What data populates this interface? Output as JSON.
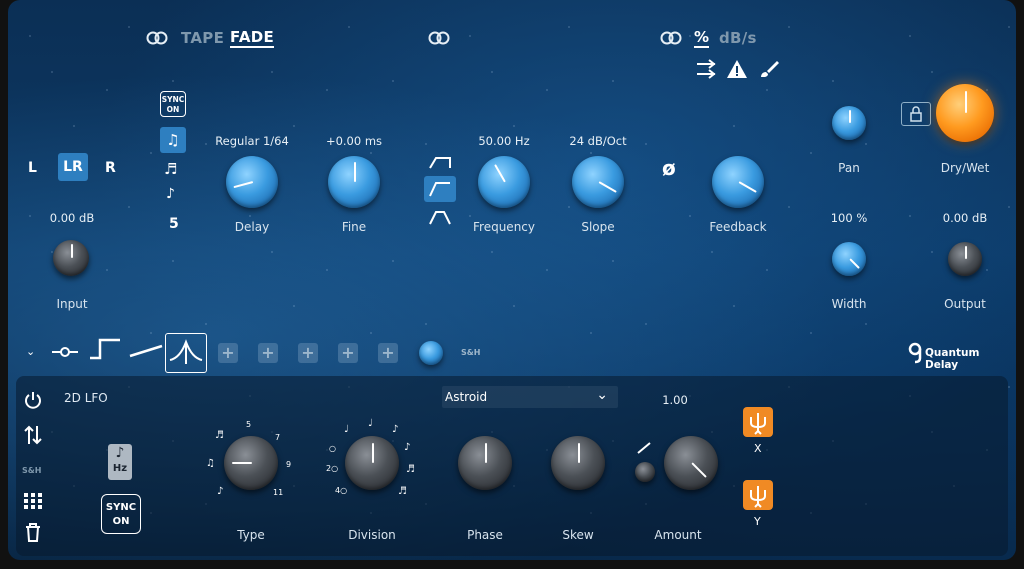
{
  "header": {
    "tape_label": "TAPE",
    "fade_label": "FADE",
    "percent_label": "%",
    "dbs_label": "dB/s"
  },
  "channel": {
    "l": "L",
    "lr": "LR",
    "r": "R"
  },
  "sync_top": {
    "line1": "SYNC",
    "line2": "ON"
  },
  "note_count": "5",
  "knobs": {
    "input": {
      "label": "Input",
      "value": "0.00 dB"
    },
    "delay": {
      "label": "Delay",
      "value": "Regular 1/64"
    },
    "fine": {
      "label": "Fine",
      "value": "+0.00 ms"
    },
    "frequency": {
      "label": "Frequency",
      "value": "50.00 Hz"
    },
    "slope": {
      "label": "Slope",
      "value": "24 dB/Oct"
    },
    "feedback": {
      "label": "Feedback"
    },
    "pan": {
      "label": "Pan"
    },
    "drywet": {
      "label": "Dry/Wet"
    },
    "width": {
      "label": "Width",
      "value": "100 %"
    },
    "output": {
      "label": "Output",
      "value": "0.00 dB"
    }
  },
  "phase_symbol": "ø",
  "mod_row": {
    "sh_label": "S&H"
  },
  "brand": {
    "name": "Quantum Delay"
  },
  "lfo": {
    "title": "2D LFO",
    "shape": "Astroid",
    "amount_value": "1.00",
    "hz_label": "Hz",
    "sync_line1": "SYNC",
    "sync_line2": "ON",
    "sh_label": "S&H",
    "x_label": "X",
    "y_label": "Y",
    "type": {
      "label": "Type",
      "ticks": [
        "5",
        "7",
        "9",
        "11"
      ]
    },
    "division": {
      "label": "Division",
      "ticks": [
        "2",
        "4"
      ]
    },
    "phase": {
      "label": "Phase"
    },
    "skew": {
      "label": "Skew"
    },
    "amount": {
      "label": "Amount"
    }
  },
  "colors": {
    "accent": "#3a9be0",
    "orange": "#f08a24"
  }
}
